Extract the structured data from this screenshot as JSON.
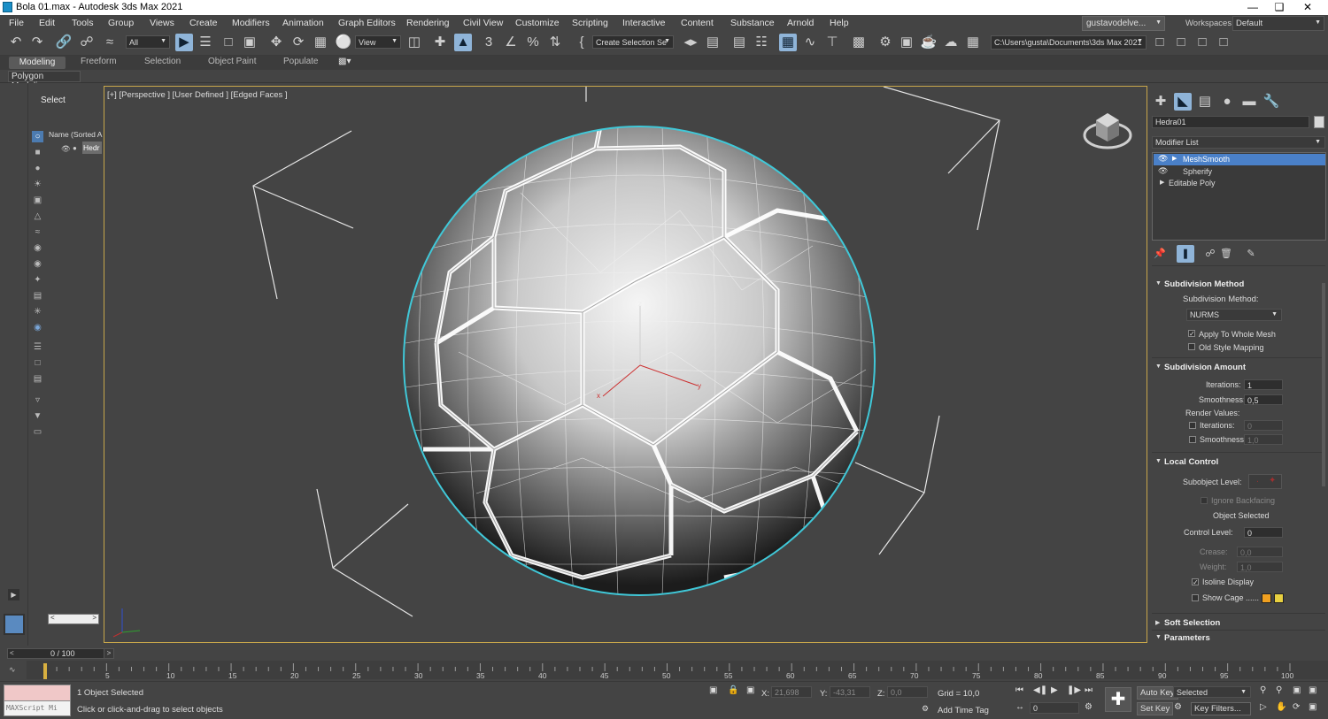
{
  "window": {
    "title": "Bola 01.max - Autodesk 3ds Max 2021"
  },
  "menu": [
    "File",
    "Edit",
    "Tools",
    "Group",
    "Views",
    "Create",
    "Modifiers",
    "Animation",
    "Graph Editors",
    "Rendering",
    "Civil View",
    "Customize",
    "Scripting",
    "Interactive",
    "Content",
    "Substance",
    "Arnold",
    "Help"
  ],
  "user": {
    "name": "gustavodelve...",
    "workspace_label": "Workspaces:",
    "workspace": "Default"
  },
  "toolbar": {
    "selection_filter": "All",
    "ref_coord": "View",
    "named_selection": "Create Selection Se",
    "project_path": "C:\\Users\\gusta\\Documents\\3ds Max 2021"
  },
  "ribbon": {
    "tabs": [
      "Modeling",
      "Freeform",
      "Selection",
      "Object Paint",
      "Populate"
    ],
    "active_tab": "Modeling",
    "sub_tab": "Polygon Modeling"
  },
  "scene_explorer": {
    "title": "Select",
    "column": "Name (Sorted A",
    "item": "Hedr"
  },
  "viewport": {
    "label": "[+] [Perspective ] [User Defined ] [Edged Faces ]",
    "axis_z": "z",
    "axis_y": "y",
    "axis_x": "x"
  },
  "command_panel": {
    "object_name": "Hedra01",
    "modifier_list": "Modifier List",
    "stack": [
      "MeshSmooth",
      "Spherify",
      "Editable Poly"
    ],
    "subdivision_method": {
      "head": "Subdivision Method",
      "label": "Subdivision Method:",
      "value": "NURMS",
      "apply_whole_mesh": "Apply To Whole Mesh",
      "old_style": "Old Style Mapping"
    },
    "subdivision_amount": {
      "head": "Subdivision Amount",
      "iterations_label": "Iterations:",
      "iterations": "1",
      "smoothness_label": "Smoothness:",
      "smoothness": "0,5",
      "render_values": "Render Values:",
      "r_iterations_label": "Iterations:",
      "r_iterations": "0",
      "r_smoothness_label": "Smoothness:",
      "r_smoothness": "1,0"
    },
    "local_control": {
      "head": "Local Control",
      "subobject_label": "Subobject Level:",
      "ignore_backfacing": "Ignore Backfacing",
      "object_selected": "Object Selected",
      "control_level_label": "Control Level:",
      "control_level": "0",
      "crease_label": "Crease:",
      "crease": "0,0",
      "weight_label": "Weight:",
      "weight": "1,0",
      "isoline_display": "Isoline Display",
      "show_cage": "Show Cage ......"
    },
    "soft_selection": "Soft Selection",
    "parameters": "Parameters"
  },
  "timeline": {
    "slider": "0 / 100",
    "ticks": [
      "5",
      "10",
      "15",
      "20",
      "25",
      "30",
      "35",
      "40",
      "45",
      "50",
      "55",
      "60",
      "65",
      "70",
      "75",
      "80",
      "85",
      "90",
      "95",
      "100"
    ]
  },
  "status": {
    "maxscript": "MAXScript Mi",
    "objects": "1 Object Selected",
    "prompt": "Click or click-and-drag to select objects",
    "x_label": "X:",
    "x": "21,698",
    "y_label": "Y:",
    "y": "-43,31",
    "z_label": "Z:",
    "z": "0,0",
    "grid": "Grid = 10,0",
    "add_time_tag": "Add Time Tag",
    "auto_key": "Auto Key",
    "key_mode": "Selected",
    "set_key": "Set Key",
    "key_filters": "Key Filters...",
    "frame": "0"
  },
  "colors": {
    "viewport_border": "#c7a64b",
    "selection_outline": "#40c8d8",
    "stack_selected": "#4a80c8",
    "cage1": "#f0a020",
    "cage2": "#e8d040"
  }
}
